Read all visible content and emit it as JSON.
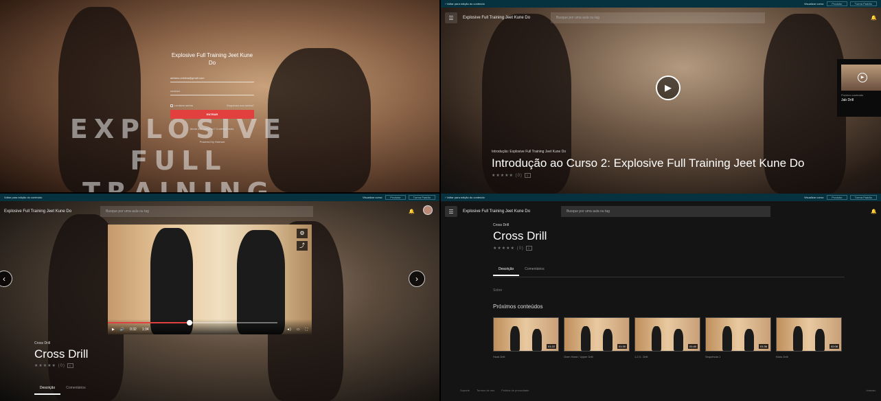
{
  "login": {
    "big_title_1": "EXPLOSIVE FULL",
    "big_title_2": "TRAINING JKD",
    "course_title": "Explosive Full Training Jeet Kune Do",
    "email_value": "adriano.cristina@gmail.com",
    "password_value": "••••••••••",
    "remember_label": "Lembrar senha",
    "forgot_label": "Esqueceu sua senha?",
    "login_button": "ENTRAR",
    "signup_text": "Ainda não comprou? Conheça mais.",
    "powered_text": "Powered by Hotmart"
  },
  "intro": {
    "topbar_back": "Voltar para edição do conteúdo",
    "topbar_view_as": "Visualizar como:",
    "topbar_select_1": "Produtor",
    "topbar_select_2": "Turma Padrão",
    "course_name": "Explosive Full Training Jeet Kune Do",
    "search_placeholder": "Busque por uma aula ou tag",
    "next_label": "Próximo conteúdo",
    "next_title": "Jab Drill",
    "module": "Introdução: Explosive Full Training Jeet Kune Do",
    "title": "Introdução ao Curso 2: Explosive Full Training Jeet Kune Do",
    "stars": "★★★★★",
    "rating_count": "(0)",
    "comments_count": "0"
  },
  "cross": {
    "topbar_back": "Voltar para edição do conteúdo",
    "topbar_view_as": "Visualizar como:",
    "topbar_select_1": "Produtor",
    "topbar_select_2": "Turma Padrão",
    "course_name": "Explosive Full Training Jeet Kune Do",
    "search_placeholder": "Busque por uma aula ou tag",
    "time_current": "0:32",
    "time_total": "1:34",
    "progress": 0.48,
    "module": "Cross Drill",
    "title": "Cross Drill",
    "stars": "★★★★★",
    "rating_count": "(0)",
    "comments_count": "0",
    "tab_description": "Descrição",
    "tab_comments": "Comentários"
  },
  "drill": {
    "topbar_back": "Voltar para edição do conteúdo",
    "topbar_view_as": "Visualizar como:",
    "topbar_select_1": "Produtor",
    "topbar_select_2": "Turma Padrão",
    "course_name": "Explosive Full Training Jeet Kune Do",
    "search_placeholder": "Busque por uma aula ou tag",
    "module": "Cross Drill",
    "title": "Cross Drill",
    "stars": "★★★★★",
    "rating_count": "(0)",
    "comments_count": "0",
    "tab_description": "Descrição",
    "tab_comments": "Comentários",
    "description_text": "Sobre",
    "next_heading": "Próximos conteúdos",
    "thumbs": [
      {
        "title": "Hook Drill",
        "duration": "01:22"
      },
      {
        "title": "Oven Hand / Upper Drill",
        "duration": "01:30"
      },
      {
        "title": "1,2,3 - Drill",
        "duration": "01:40"
      },
      {
        "title": "Sequência 1",
        "duration": "01:36"
      },
      {
        "title": "Kicks Drill",
        "duration": "02:08"
      }
    ],
    "footer_support": "Suporte",
    "footer_terms": "Termos de uso",
    "footer_privacy": "Política de privacidade",
    "footer_brand": "hotmart"
  },
  "colors": {
    "accent": "#e2403f",
    "topbar": "#06323f"
  },
  "icons": {
    "play": "play-icon",
    "menu": "menu-icon",
    "bell": "bell-icon",
    "arrow_left": "chevron-left-icon",
    "arrow_right": "chevron-right-icon"
  }
}
